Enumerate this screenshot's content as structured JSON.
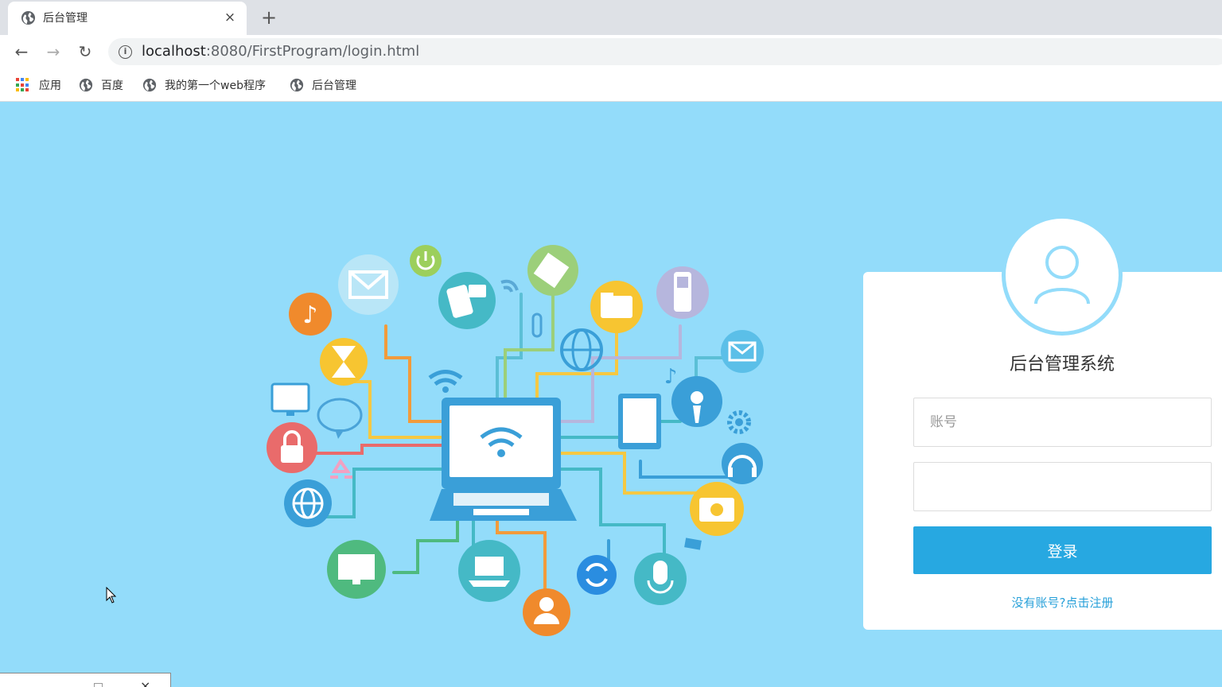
{
  "browser": {
    "tab": {
      "title": "后台管理",
      "favicon": "globe-icon",
      "close": "×"
    },
    "new_tab": "+",
    "nav": {
      "back": "←",
      "forward": "→",
      "reload": "↻"
    },
    "address": {
      "host": "localhost",
      "path": ":8080/FirstProgram/login.html",
      "info": "i"
    },
    "bookmarks": [
      {
        "label": "应用",
        "icon": "apps-grid-icon"
      },
      {
        "label": "百度",
        "icon": "globe-icon"
      },
      {
        "label": "我的第一个web程序",
        "icon": "globe-icon"
      },
      {
        "label": "后台管理",
        "icon": "globe-icon"
      }
    ]
  },
  "login": {
    "title": "后台管理系统",
    "username_placeholder": "账号",
    "password_placeholder": "",
    "submit": "登录",
    "register": "没有账号?点击注册"
  },
  "colors": {
    "page_bg": "#93dcfa",
    "primary": "#27a8e1",
    "link": "#27a0d9",
    "card": "#ffffff"
  },
  "taskbar_window": {
    "close": "×"
  }
}
